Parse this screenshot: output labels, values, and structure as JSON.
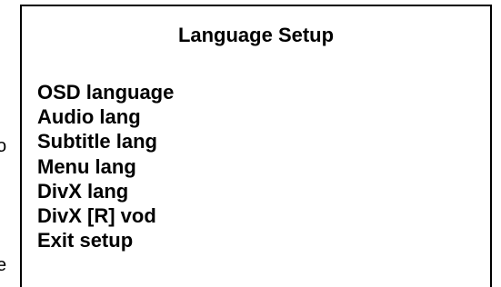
{
  "edge_text": {
    "glyph_1": "o",
    "glyph_2": "e"
  },
  "menu": {
    "title": "Language Setup",
    "items": [
      {
        "label": "OSD language"
      },
      {
        "label": "Audio lang"
      },
      {
        "label": "Subtitle lang"
      },
      {
        "label": "Menu lang"
      },
      {
        "label": "DivX lang"
      },
      {
        "label": "DivX [R] vod"
      },
      {
        "label": "Exit setup"
      }
    ]
  },
  "colors": {
    "text": "#000000",
    "background": "#ffffff",
    "border": "#000000"
  }
}
